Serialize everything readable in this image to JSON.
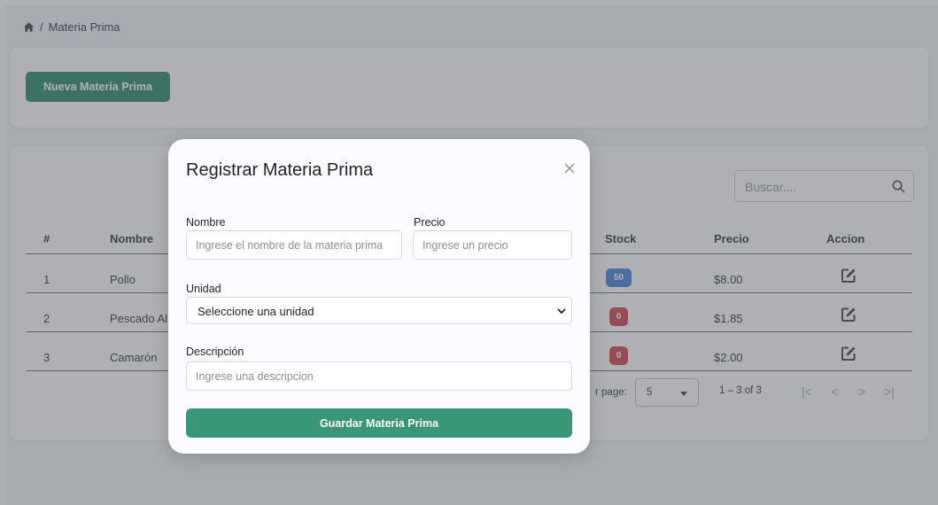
{
  "breadcrumb": {
    "separator": "/",
    "current": "Materia Prima"
  },
  "toolbar": {
    "new_button_label": "Nueva Materia Prima"
  },
  "search": {
    "placeholder": "Buscar...."
  },
  "table": {
    "columns": [
      "#",
      "Nombre",
      "Stock",
      "Precio",
      "Accion"
    ],
    "rows": [
      {
        "num": "1",
        "name": "Pollo",
        "stock": "50",
        "stock_color": "#3a7bd5",
        "price": "$8.00"
      },
      {
        "num": "2",
        "name": "Pescado Al",
        "stock": "0",
        "stock_color": "#c8373e",
        "price": "$1.85"
      },
      {
        "num": "3",
        "name": "Camarón",
        "stock": "0",
        "stock_color": "#c8373e",
        "price": "$2.00"
      }
    ],
    "action_icon": "edit-icon"
  },
  "pagination": {
    "rows_per_page_label": "r page:",
    "rows_per_page_value": "5",
    "range_text": "1 – 3 of 3",
    "first": "|<",
    "prev": "<",
    "next": ">",
    "last": ">|"
  },
  "modal": {
    "title": "Registrar Materia Prima",
    "close_icon": "close-icon",
    "nombre_label": "Nombre",
    "nombre_placeholder": "Ingrese el nombre de la materia prima",
    "precio_label": "Precio",
    "precio_placeholder": "Ingrese un precio",
    "unidad_label": "Unidad",
    "unidad_selected": "Seleccione una unidad",
    "descripcion_label": "Descripción",
    "descripcion_placeholder": "Ingrese una descripcion",
    "save_label": "Guardar Materia Prima"
  },
  "colors": {
    "primary_green": "#1a7f5a",
    "save_green": "#399677",
    "badge_blue": "#3a7bd5",
    "badge_red": "#c8373e"
  }
}
